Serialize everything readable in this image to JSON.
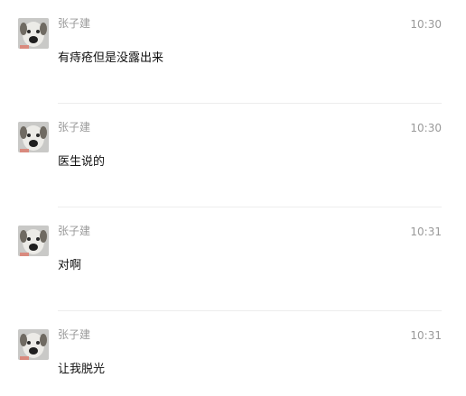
{
  "messages": [
    {
      "sender": "张子建",
      "time": "10:30",
      "text": "有痔疮但是没露出来",
      "avatar_icon": "dog-avatar-icon"
    },
    {
      "sender": "张子建",
      "time": "10:30",
      "text": "医生说的",
      "avatar_icon": "dog-avatar-icon"
    },
    {
      "sender": "张子建",
      "time": "10:31",
      "text": "对啊",
      "avatar_icon": "dog-avatar-icon"
    },
    {
      "sender": "张子建",
      "time": "10:31",
      "text": "让我脱光",
      "avatar_icon": "dog-avatar-icon"
    }
  ]
}
